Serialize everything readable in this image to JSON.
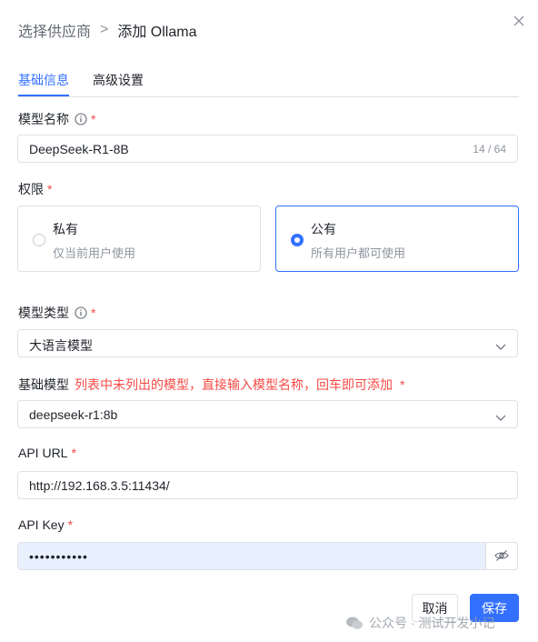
{
  "header": {
    "breadcrumb_parent": "选择供应商",
    "separator": ">",
    "current": "添加 Ollama"
  },
  "tabs": [
    {
      "label": "基础信息",
      "active": true
    },
    {
      "label": "高级设置",
      "active": false
    }
  ],
  "form": {
    "model_name": {
      "label": "模型名称",
      "required_mark": "*",
      "value": "DeepSeek-R1-8B",
      "counter": "14 / 64"
    },
    "permission": {
      "label": "权限",
      "required_mark": "*",
      "options": [
        {
          "title": "私有",
          "desc": "仅当前用户使用",
          "selected": false
        },
        {
          "title": "公有",
          "desc": "所有用户都可使用",
          "selected": true
        }
      ]
    },
    "model_type": {
      "label": "模型类型",
      "required_mark": "*",
      "value": "大语言模型"
    },
    "base_model": {
      "label": "基础模型",
      "hint": "列表中未列出的模型，直接输入模型名称，回车即可添加",
      "required_mark": "*",
      "value": "deepseek-r1:8b"
    },
    "api_url": {
      "label": "API URL",
      "required_mark": "*",
      "value": "http://192.168.3.5:11434/"
    },
    "api_key": {
      "label": "API Key",
      "required_mark": "*",
      "value": "•••••••••••"
    }
  },
  "footer": {
    "cancel_label": "取消",
    "save_label": "保存"
  },
  "watermark": {
    "text": "公众号 · 测试开发小记"
  },
  "colors": {
    "primary": "#3370ff",
    "required": "#f54a45",
    "border": "#dee0e3",
    "muted": "#8f959e",
    "autofill_bg": "#e8f0fe"
  },
  "icons": {
    "close": "close-icon",
    "info": "info-icon",
    "chevron": "chevron-down-icon",
    "eye": "eye-off-icon"
  }
}
